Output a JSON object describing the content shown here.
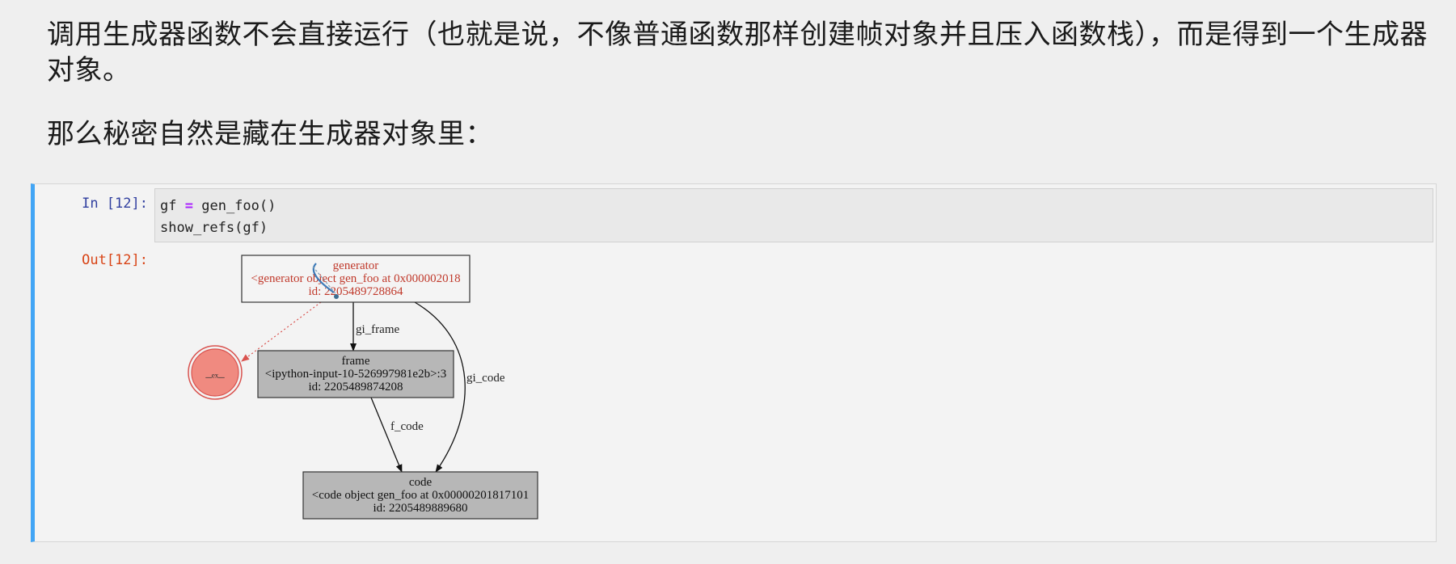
{
  "markdown": {
    "line1": "调用生成器函数不会直接运行（也就是说，不像普通函数那样创建帧对象并且压入函数栈），而是得到一个生成器",
    "line2": "对象。",
    "line3": "那么秘密自然是藏在生成器对象里："
  },
  "cell": {
    "in_prompt": "In [12]:",
    "code_line1_var": "gf",
    "code_line1_op": "=",
    "code_line1_call": "gen_foo()",
    "code_line2": "show_refs(gf)",
    "out_prompt": "Out[12]:"
  },
  "graph": {
    "generator_node": {
      "title": "generator",
      "repr": "<generator object gen_foo at 0x000002018",
      "id": "id: 2205489728864",
      "color": "#c0392b"
    },
    "frame_node": {
      "title": "frame",
      "repr": "<ipython-input-10-526997981e2b>:3",
      "id": "id: 2205489874208",
      "fill": "#b7b7b7"
    },
    "code_node": {
      "title": "code",
      "repr": "<code object gen_foo at 0x00000201817101",
      "id": "id: 2205489889680",
      "fill": "#b7b7b7"
    },
    "circle_node": {
      "label": "_ₑₓ_",
      "fill": "#f08a80",
      "stroke": "#d9534f"
    },
    "edges": {
      "gi_frame": "gi_frame",
      "gi_code": "gi_code",
      "f_code": "f_code"
    }
  },
  "colors": {
    "cell_accent": "#42a5f5",
    "in_prompt": "#303f9f",
    "out_prompt": "#d84315"
  }
}
